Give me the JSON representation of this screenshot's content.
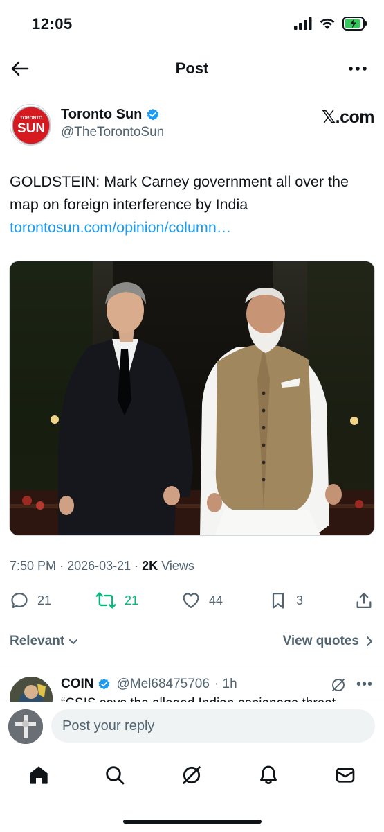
{
  "status_bar": {
    "time": "12:05"
  },
  "header": {
    "title": "Post"
  },
  "author": {
    "name": "Toronto Sun",
    "handle": "@TheTorontoSun",
    "avatar_text_top": "TORONTO",
    "avatar_text_main": "SUN",
    "verified": true,
    "source": "𝕏.com"
  },
  "post": {
    "text": "GOLDSTEIN: Mark Carney government all over the map on foreign interference by India",
    "link": "torontosun.com/opinion/column…"
  },
  "meta": {
    "time": "7:50 PM",
    "date": "2026-03-21",
    "views_count": "2K",
    "views_label": "Views"
  },
  "actions": {
    "replies": "21",
    "reposts": "21",
    "likes": "44",
    "bookmarks": "3"
  },
  "sort": {
    "left_label": "Relevant",
    "right_label": "View quotes"
  },
  "reply": {
    "name": "COIN",
    "handle": "@Mel68475706",
    "time": "· 1h",
    "text": "“CSIS says the alleged Indian espionage threat..."
  },
  "compose": {
    "placeholder": "Post your reply"
  },
  "colors": {
    "accent": "#1d9bf0",
    "repost_green": "#00ba7c",
    "text_secondary": "#536471",
    "battery_green": "#34c759"
  }
}
